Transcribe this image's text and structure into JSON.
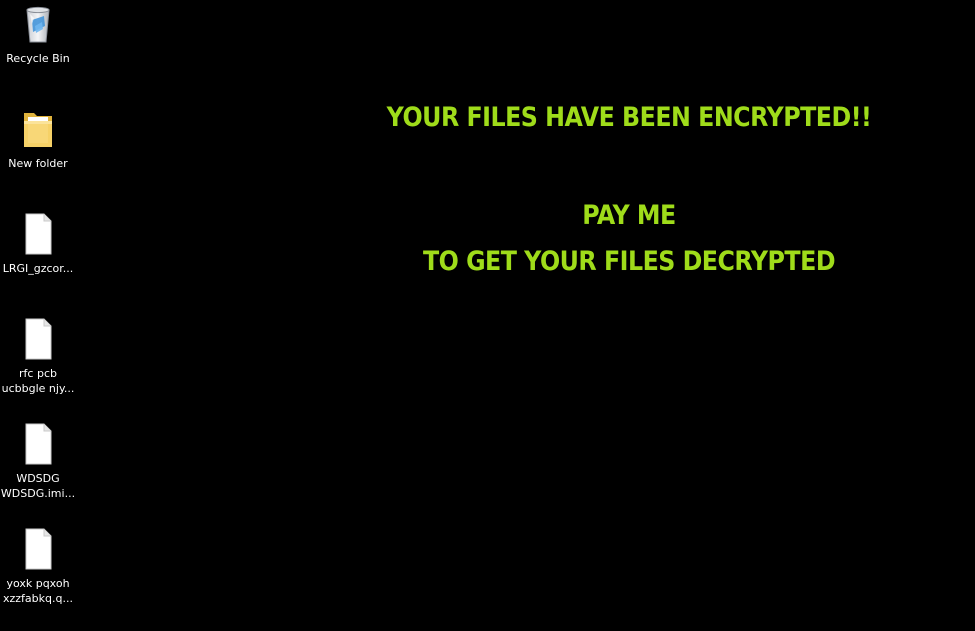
{
  "desktop": {
    "background_color": "#000000",
    "icons": [
      {
        "label": "Recycle Bin",
        "icon": "recycle-bin-icon"
      },
      {
        "label": "New folder",
        "icon": "folder-icon"
      },
      {
        "label": "LRGI_gzcor...",
        "icon": "file-icon"
      },
      {
        "label": "rfc pcb\nucbbgle njy...",
        "icon": "file-icon"
      },
      {
        "label": "WDSDG\nWDSDG.imi...",
        "icon": "file-icon"
      },
      {
        "label": "yoxk pqxoh\nxzzfabkq.q...",
        "icon": "file-icon"
      }
    ]
  },
  "ransom_note": {
    "line1": "YOUR FILES HAVE BEEN ENCRYPTED!!",
    "line2": "PAY ME",
    "line3": "TO GET YOUR FILES DECRYPTED",
    "text_color": "#9fdc1a"
  }
}
